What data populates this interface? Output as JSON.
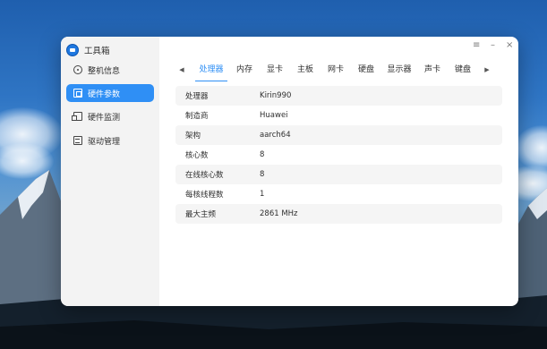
{
  "app": {
    "title": "工具箱",
    "icon": "toolbox-icon",
    "accent_color": "#2f8ff5"
  },
  "window_controls": {
    "menu": "≡",
    "minimize": "–",
    "close": "×"
  },
  "sidebar": {
    "items": [
      {
        "label": "整机信息",
        "icon": "info-icon",
        "active": false
      },
      {
        "label": "硬件参数",
        "icon": "chip-icon",
        "active": true
      },
      {
        "label": "硬件监测",
        "icon": "monitor-icon",
        "active": false
      },
      {
        "label": "驱动管理",
        "icon": "driver-icon",
        "active": false
      }
    ]
  },
  "tabs": {
    "prev": "◀",
    "next": "▶",
    "items": [
      {
        "label": "处理器",
        "active": true
      },
      {
        "label": "内存",
        "active": false
      },
      {
        "label": "显卡",
        "active": false
      },
      {
        "label": "主板",
        "active": false
      },
      {
        "label": "网卡",
        "active": false
      },
      {
        "label": "硬盘",
        "active": false
      },
      {
        "label": "显示器",
        "active": false
      },
      {
        "label": "声卡",
        "active": false
      },
      {
        "label": "键盘",
        "active": false
      }
    ]
  },
  "cpu_info": {
    "rows": [
      {
        "key": "处理器",
        "value": "Kirin990"
      },
      {
        "key": "制造商",
        "value": "Huawei"
      },
      {
        "key": "架构",
        "value": "aarch64"
      },
      {
        "key": "核心数",
        "value": "8"
      },
      {
        "key": "在线核心数",
        "value": "8"
      },
      {
        "key": "每核线程数",
        "value": "1"
      },
      {
        "key": "最大主频",
        "value": "2861 MHz"
      }
    ]
  }
}
